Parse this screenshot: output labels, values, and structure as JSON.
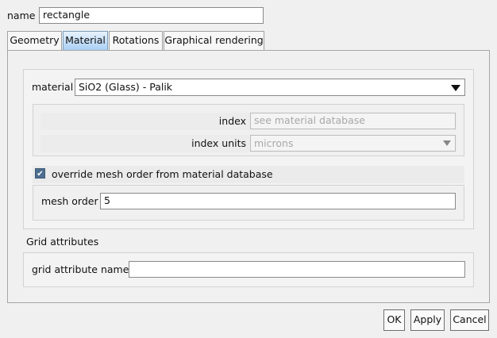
{
  "name_label": "name",
  "name_value": "rectangle",
  "tabs": [
    {
      "label": "Geometry",
      "active": false
    },
    {
      "label": "Material",
      "active": true
    },
    {
      "label": "Rotations",
      "active": false
    },
    {
      "label": "Graphical rendering",
      "active": false
    }
  ],
  "material": {
    "label": "material",
    "selected": "SiO2 (Glass) - Palik",
    "index_label": "index",
    "index_placeholder": "see material database",
    "index_units_label": "index units",
    "index_units_value": "microns"
  },
  "mesh": {
    "override_label": "override mesh order from material database",
    "override_checked": true,
    "checkmark": "✔",
    "order_label": "mesh order",
    "order_value": "5"
  },
  "grid": {
    "section_title": "Grid attributes",
    "name_label": "grid attribute name",
    "name_value": ""
  },
  "buttons": {
    "ok": "OK",
    "apply": "Apply",
    "cancel": "Cancel"
  },
  "colors": {
    "active_tab": "#a9d0f5",
    "checkbox": "#4d6e8f"
  }
}
